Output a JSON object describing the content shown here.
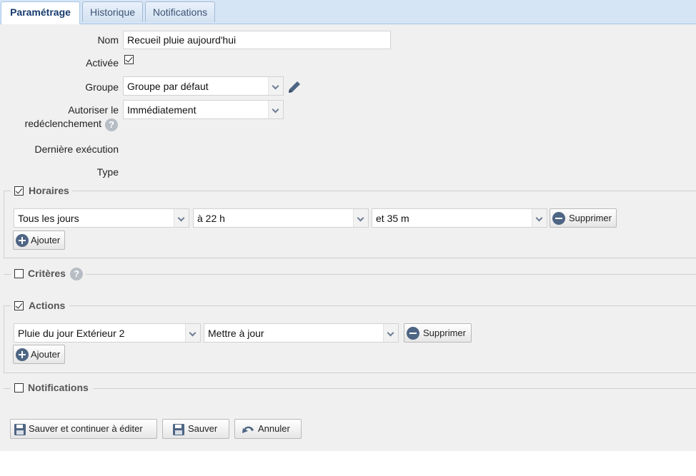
{
  "tabs": [
    {
      "label": "Paramétrage",
      "active": true
    },
    {
      "label": "Historique",
      "active": false
    },
    {
      "label": "Notifications",
      "active": false
    }
  ],
  "form": {
    "name_label": "Nom",
    "name_value": "Recueil pluie aujourd'hui",
    "enabled_label": "Activée",
    "enabled_checked": true,
    "group_label": "Groupe",
    "group_value": "Groupe par défaut",
    "retrigger_label_line1": "Autoriser le",
    "retrigger_label_line2": "redéclenchement",
    "retrigger_value": "Immédiatement",
    "last_exec_label": "Dernière exécution",
    "type_label": "Type",
    "help_glyph": "?"
  },
  "schedules": {
    "legend": "Horaires",
    "checked": true,
    "row": {
      "day": "Tous les jours",
      "hour": "à 22 h",
      "minute": "et 35 m",
      "delete_label": "Supprimer"
    },
    "add_label": "Ajouter"
  },
  "criteria": {
    "legend": "Critères",
    "checked": false
  },
  "actions": {
    "legend": "Actions",
    "checked": true,
    "row": {
      "device": "Pluie du jour Extérieur 2",
      "action": "Mettre à jour",
      "delete_label": "Supprimer"
    },
    "add_label": "Ajouter"
  },
  "notifications": {
    "legend": "Notifications",
    "checked": false
  },
  "footer": {
    "save_continue_label": "Sauver et continuer à éditer",
    "save_label": "Sauver",
    "cancel_label": "Annuler"
  },
  "colors": {
    "tabbar_bg": "#d6e5f6",
    "icon_color": "#4e6584",
    "content_bg": "#f0f0f0"
  }
}
